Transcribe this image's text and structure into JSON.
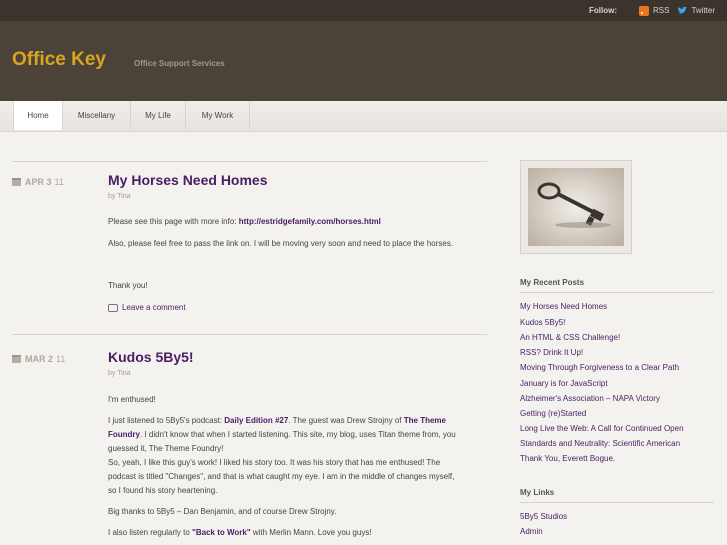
{
  "topbar": {
    "follow_label": "Follow:",
    "rss_label": "RSS",
    "twitter_label": "Twitter"
  },
  "site": {
    "title": "Office Key",
    "tagline": "Office Support Services"
  },
  "nav": {
    "items": [
      "Home",
      "Miscellany",
      "My Life",
      "My Work"
    ],
    "active": "Home"
  },
  "posts": [
    {
      "date": "APR 3",
      "year": "11",
      "title": "My Horses Need Homes",
      "byline": "by Tina",
      "p1_text": "Please see this page with more info: ",
      "p1_link": "http://estridgefamily.com/horses.html",
      "p2": "Also, please feel free to pass the link on. I will be moving very soon and need to place the horses.",
      "p3": "Thank you!",
      "comment": "Leave a comment"
    },
    {
      "date": "MAR 2",
      "year": "11",
      "title": "Kudos 5By5!",
      "byline": "by Tina",
      "p1": "I'm enthused!",
      "p2_a": "I just listened to 5By5's podcast: ",
      "p2_link1": "Daily Edition #27",
      "p2_b": ". The guest was Drew Strojny of ",
      "p2_link2": "The Theme Foundry",
      "p2_c": ". I didn't know that when I started listening. This site, my blog, uses Titan theme from, you guessed it, The Theme Foundry!",
      "p3": "So, yeah, I like this guy's work! I liked his story too. It was his story that has me enthused! The podcast is titled \"Changes\", and that is what caught my eye. I am in the middle of changes myself, so I found his story heartening.",
      "p4": "Big thanks to 5By5 – Dan Benjamin, and of course Drew Strojny.",
      "p5_a": "I also listen regularly to ",
      "p5_link": "\"Back to Work\"",
      "p5_b": " with Merlin Mann. Love you guys!"
    }
  ],
  "sidebar": {
    "recent_title": "My Recent Posts",
    "recent": [
      "My Horses Need Homes",
      "Kudos 5By5!",
      "An HTML & CSS Challenge!",
      "RSS? Drink It Up!",
      "Moving Through Forgiveness to a Clear Path",
      "January is for JavaScript",
      "Alzheimer's Association – NAPA Victory",
      "Getting (re)Started",
      "Long Live the Web: A Call for Continued Open Standards and Neutrality: Scientific American",
      "Thank You, Everett Bogue."
    ],
    "links_title": "My Links",
    "links": [
      "5By5 Studios",
      "Admin"
    ]
  },
  "colors": {
    "accent": "#d9a521",
    "header_bg": "#4c4338",
    "link": "#4a1d63"
  }
}
